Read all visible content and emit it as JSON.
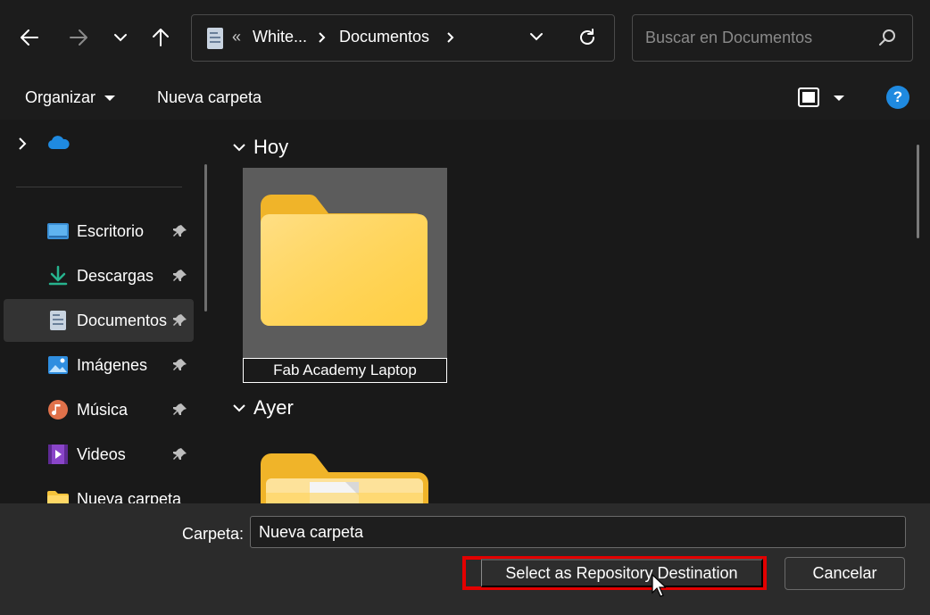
{
  "address_bar": {
    "back_icon": "arrow-left-icon",
    "forward_icon": "arrow-right-icon",
    "recent_icon": "chevron-down-icon",
    "up_icon": "arrow-up-icon",
    "overflow": "«",
    "crumbs": [
      "White...",
      "Documentos"
    ],
    "refresh_icon": "refresh-icon"
  },
  "search": {
    "placeholder": "Buscar en Documentos"
  },
  "command_bar": {
    "organize_label": "Organizar",
    "new_folder_label": "Nueva carpeta",
    "help_label": "?"
  },
  "nav_pane": {
    "items": [
      {
        "label": "Escritorio",
        "icon": "desktop-icon",
        "pinned": true
      },
      {
        "label": "Descargas",
        "icon": "download-icon",
        "pinned": true
      },
      {
        "label": "Documentos",
        "icon": "document-icon",
        "pinned": true,
        "selected": true
      },
      {
        "label": "Imágenes",
        "icon": "pictures-icon",
        "pinned": true
      },
      {
        "label": "Música",
        "icon": "music-icon",
        "pinned": true
      },
      {
        "label": "Videos",
        "icon": "video-icon",
        "pinned": true
      },
      {
        "label": "Nueva carpeta",
        "icon": "folder-icon",
        "pinned": false
      }
    ]
  },
  "content": {
    "groups": [
      {
        "title": "Hoy",
        "items": [
          {
            "name": "Fab Academy Laptop",
            "type": "folder",
            "renaming": true
          }
        ]
      },
      {
        "title": "Ayer",
        "items": [
          {
            "name": "",
            "type": "folder"
          }
        ]
      }
    ]
  },
  "footer": {
    "folder_label": "Carpeta:",
    "folder_value": "Nueva carpeta",
    "select_button": "Select as Repository Destination",
    "cancel_button": "Cancelar",
    "highlight_color": "#e30000"
  }
}
